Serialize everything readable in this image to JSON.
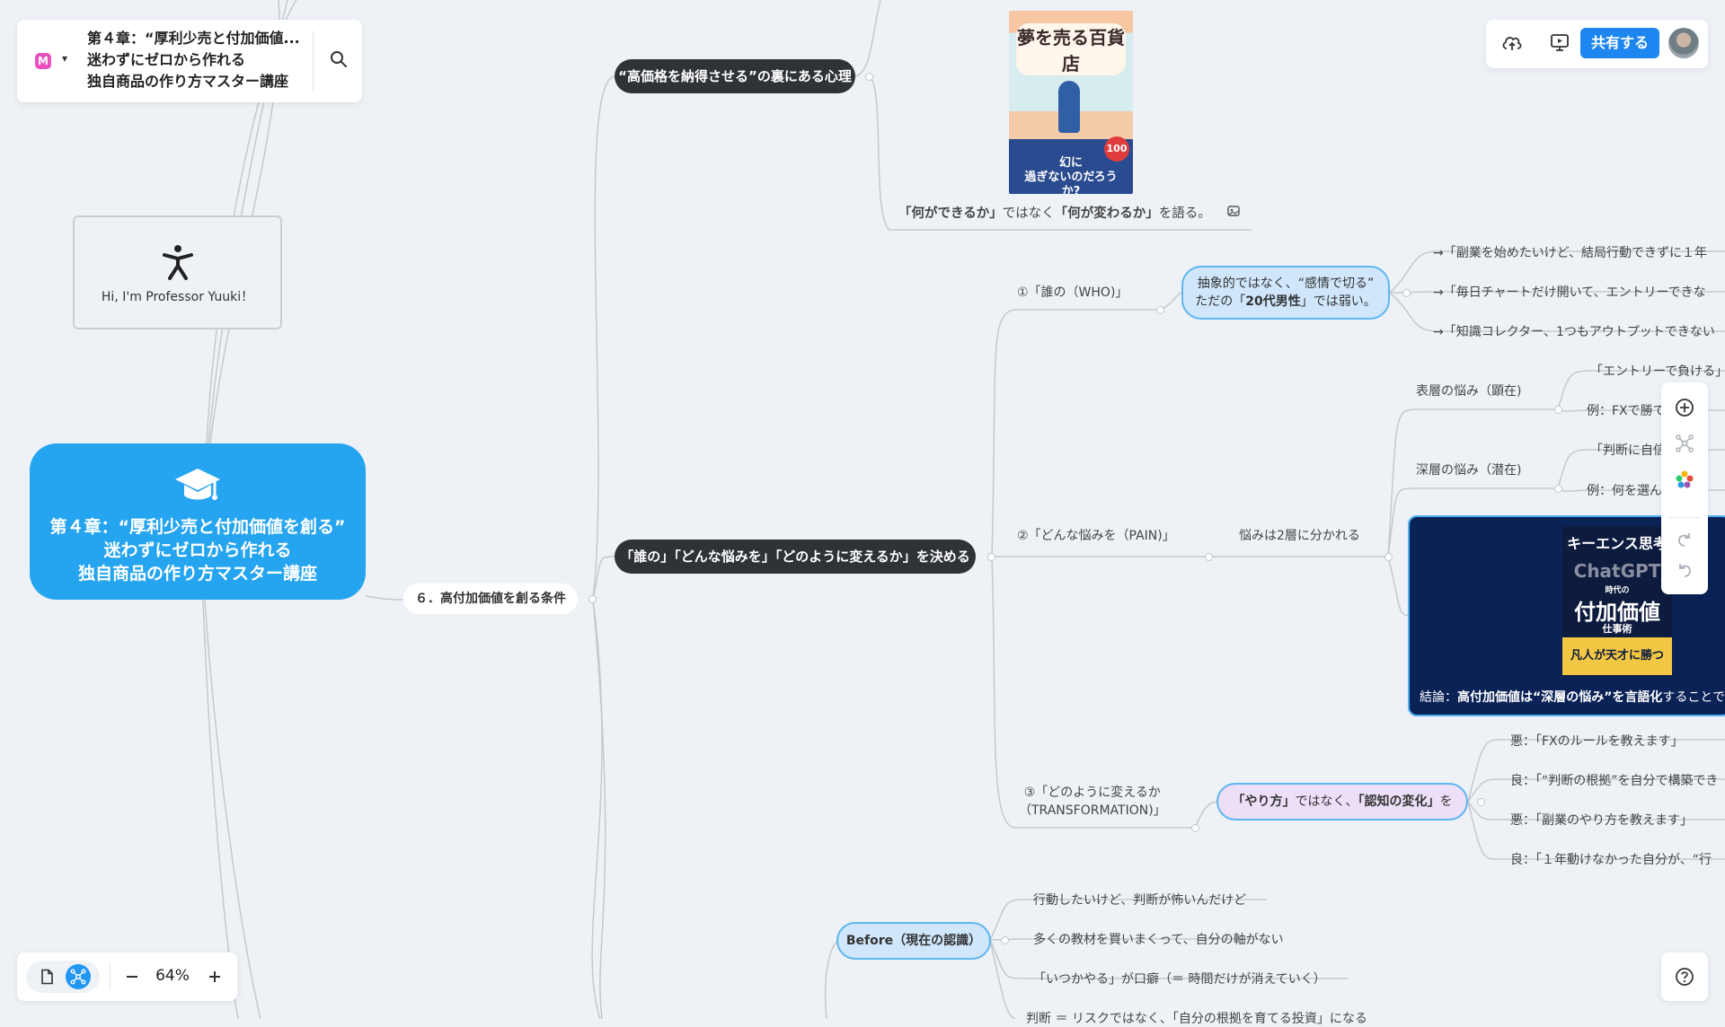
{
  "document": {
    "title": "第４章：“厚利少売と付加価値...\n迷わずにゼロから作れる\n独自商品の作り方マスター講座",
    "logo_letter": "M"
  },
  "toolbar": {
    "share_label": "共有する"
  },
  "zoom": {
    "level": "64%"
  },
  "sticky": {
    "text": "Hi, I'm  Professor  Yuuki！"
  },
  "root": {
    "text": "第４章：“厚利少売と付加価値を創る”\n迷わずにゼロから作れる\n独自商品の作り方マスター講座"
  },
  "branch": {
    "label": "６．高付加価値を創る条件"
  },
  "topics": {
    "psychology": "“高価格を納得させる”の裏にある心理",
    "decide": "「誰の」「どんな悩みを」「どのように変えるか」を決める",
    "before": "Before（現在の認識）"
  },
  "book1": {
    "title": "夢を売る百貨店",
    "subtitle": "幻に\n過ぎないのだろうか?",
    "badge": "100"
  },
  "caption_change": {
    "text_a": "「何ができるか」",
    "text_b": "ではなく",
    "text_c": "「何が変わるか」",
    "text_d": "を語る。"
  },
  "who": {
    "label": "①「誰の（WHO)」",
    "bubble_line1": "抽象的ではなく、“感情で切る”",
    "bubble_line2_a": "ただの「",
    "bubble_line2_b": "20代男性",
    "bubble_line2_c": "」では弱い。",
    "examples": [
      "→「副業を始めたいけど、結局行動できずに１年",
      "→「毎日チャートだけ開いて、エントリーできな",
      "→「知識コレクター、1つもアウトプットできない"
    ]
  },
  "pain": {
    "label": "②「どんな悩みを（PAIN)」",
    "layers_label": "悩みは2層に分かれる",
    "surface": "表層の悩み（顕在)",
    "deep": "深層の悩み（潜在)",
    "surface_items": [
      "「エントリーで負ける」",
      "例：FXで勝て　副業"
    ],
    "deep_items": [
      "「判断に自信　」「",
      "例：何を選ん　か、"
    ]
  },
  "conclusion": {
    "text_a": "結論：",
    "text_b": "高付加価値は“深層の悩み”を言語化",
    "text_c": "することで",
    "book_line1": "キーエンス思考",
    "book_line2": "ChatGPT",
    "book_line3": "時代の",
    "book_line4": "付加価値",
    "book_line5": "仕事術",
    "book_line6": "凡人が天才に勝つ"
  },
  "transformation": {
    "label_line1": "③「どのように変えるか",
    "label_line2": "（TRANSFORMATION)」",
    "bubble_a": "「やり方」",
    "bubble_b": "ではなく、",
    "bubble_c": "「認知の変化」",
    "bubble_d": "を",
    "items": [
      "悪：「FXのルールを教えます」",
      "良：「“判断の根拠”を自分で構築でき",
      "悪：「副業のやり方を教えます」",
      "良：「１年動けなかった自分が、“行"
    ]
  },
  "before_items": [
    "行動したいけど、判断が怖いんだけど",
    "多くの教材を買いまくって、自分の軸がない",
    "「いつかやる」が口癖（＝ 時間だけが消えていく）",
    "判断 ＝ リスクではなく、「自分の根拠を育てる投資」になる"
  ]
}
